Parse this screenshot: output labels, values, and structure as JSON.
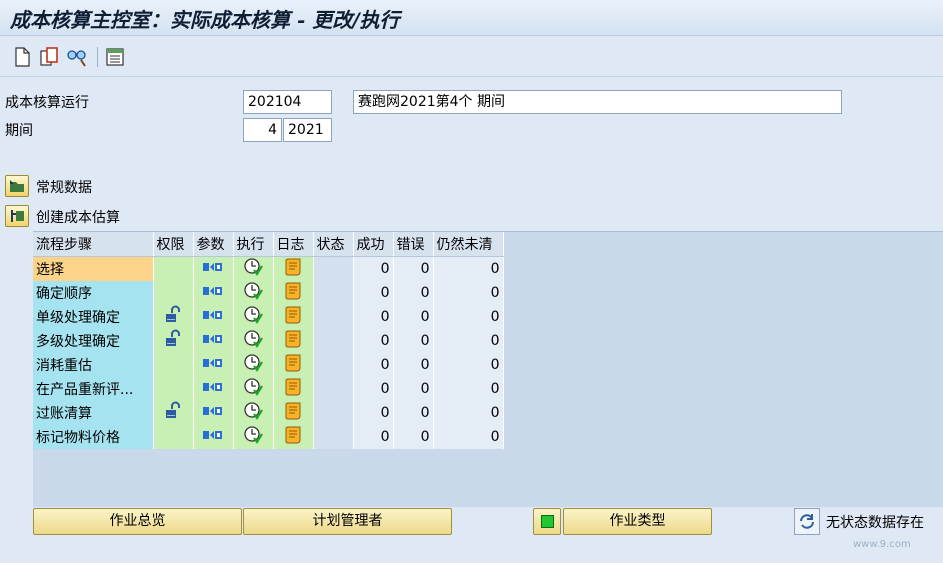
{
  "window": {
    "title": "成本核算主控室：实际成本核算 - 更改/执行"
  },
  "toolbar": {
    "items": [
      "new-document-icon",
      "copy-icon",
      "settings-glasses-icon",
      "list-icon"
    ]
  },
  "header": {
    "run_label": "成本核算运行",
    "run_id": "202104",
    "run_desc": "赛跑网2021第4个 期间",
    "period_label": "期间",
    "period_value": "4",
    "period_year": "2021"
  },
  "sections": {
    "general": "常规数据",
    "create": "创建成本估算"
  },
  "grid": {
    "headers": [
      "流程步骤",
      "权限",
      "参数",
      "执行",
      "日志",
      "状态",
      "成功",
      "错误",
      "仍然未清"
    ],
    "rows": [
      {
        "step": "选择",
        "lock": false,
        "success": "0",
        "error": "0",
        "open": "0"
      },
      {
        "step": "确定顺序",
        "lock": false,
        "success": "0",
        "error": "0",
        "open": "0"
      },
      {
        "step": "单级处理确定",
        "lock": true,
        "success": "0",
        "error": "0",
        "open": "0"
      },
      {
        "step": "多级处理确定",
        "lock": true,
        "success": "0",
        "error": "0",
        "open": "0"
      },
      {
        "step": "消耗重估",
        "lock": false,
        "success": "0",
        "error": "0",
        "open": "0"
      },
      {
        "step": "在产品重新评...",
        "lock": false,
        "success": "0",
        "error": "0",
        "open": "0"
      },
      {
        "step": "过账清算",
        "lock": true,
        "success": "0",
        "error": "0",
        "open": "0"
      },
      {
        "step": "标记物料价格",
        "lock": false,
        "success": "0",
        "error": "0",
        "open": "0"
      }
    ]
  },
  "footer": {
    "btn_overview": "作业总览",
    "btn_planner": "计划管理者",
    "btn_activity": "作业类型",
    "status": "无状态数据存在"
  },
  "watermark": "www.9.com"
}
